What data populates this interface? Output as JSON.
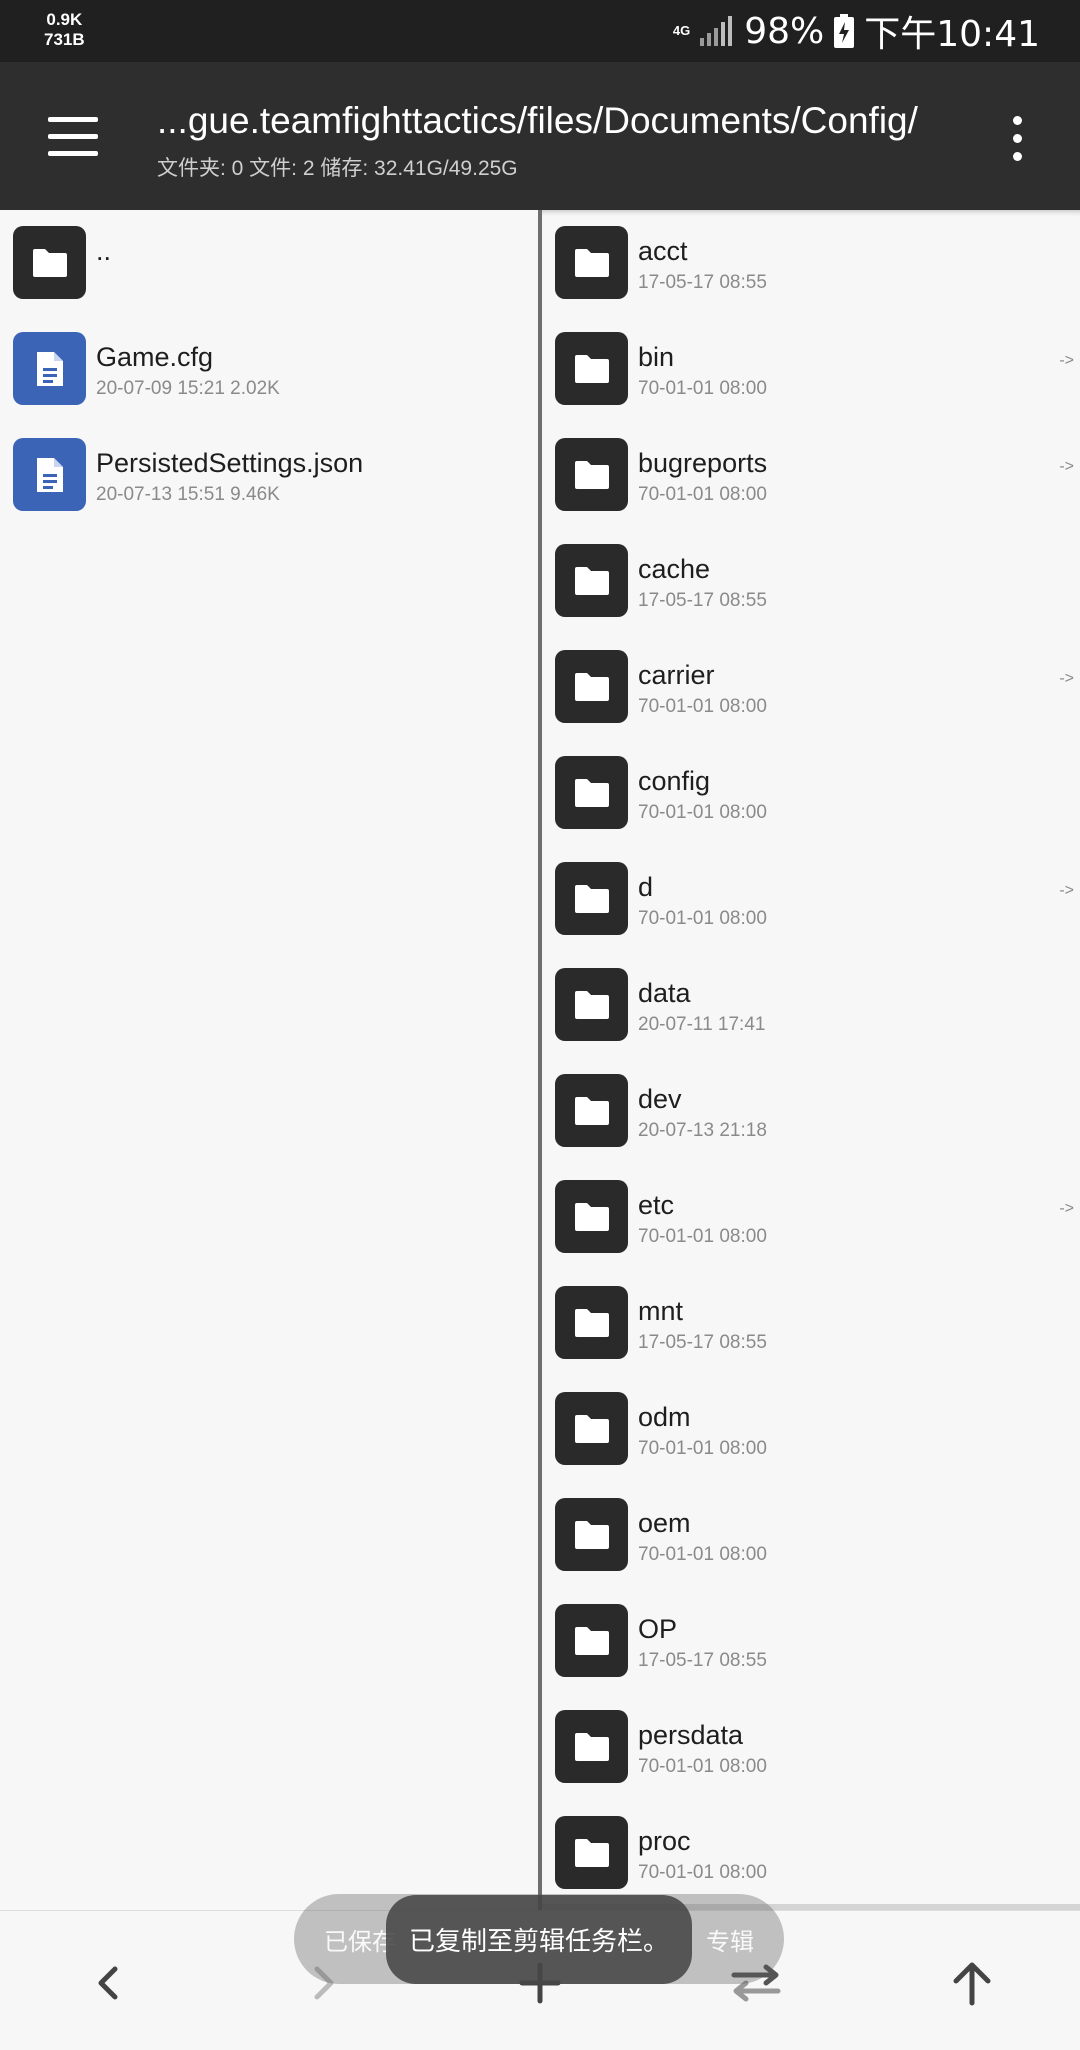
{
  "status_bar": {
    "net_speed_up": "0.9K",
    "net_speed_down": "731B",
    "network_type": "4G",
    "battery": "98%",
    "time": "下午10:41"
  },
  "toolbar": {
    "path": "...gue.teamfighttactics/files/Documents/Config/",
    "stats": "文件夹: 0  文件: 2  储存: 32.41G/49.25G",
    "menu_icon": "hamburger-menu-icon",
    "more_icon": "more-vertical-icon"
  },
  "left_pane": {
    "items": [
      {
        "name": "..",
        "meta": "",
        "type": "folder"
      },
      {
        "name": "Game.cfg",
        "meta": "20-07-09 15:21   2.02K",
        "type": "file"
      },
      {
        "name": "PersistedSettings.json",
        "meta": "20-07-13 15:51   9.46K",
        "type": "file"
      }
    ]
  },
  "right_pane": {
    "items": [
      {
        "name": "acct",
        "meta": "17-05-17 08:55",
        "link": ""
      },
      {
        "name": "bin",
        "meta": "70-01-01 08:00",
        "link": "->"
      },
      {
        "name": "bugreports",
        "meta": "70-01-01 08:00",
        "link": "->"
      },
      {
        "name": "cache",
        "meta": "17-05-17 08:55",
        "link": ""
      },
      {
        "name": "carrier",
        "meta": "70-01-01 08:00",
        "link": "->"
      },
      {
        "name": "config",
        "meta": "70-01-01 08:00",
        "link": ""
      },
      {
        "name": "d",
        "meta": "70-01-01 08:00",
        "link": "->"
      },
      {
        "name": "data",
        "meta": "20-07-11 17:41",
        "link": ""
      },
      {
        "name": "dev",
        "meta": "20-07-13 21:18",
        "link": ""
      },
      {
        "name": "etc",
        "meta": "70-01-01 08:00",
        "link": "->"
      },
      {
        "name": "mnt",
        "meta": "17-05-17 08:55",
        "link": ""
      },
      {
        "name": "odm",
        "meta": "70-01-01 08:00",
        "link": ""
      },
      {
        "name": "oem",
        "meta": "70-01-01 08:00",
        "link": ""
      },
      {
        "name": "OP",
        "meta": "17-05-17 08:55",
        "link": ""
      },
      {
        "name": "persdata",
        "meta": "70-01-01 08:00",
        "link": ""
      },
      {
        "name": "proc",
        "meta": "70-01-01 08:00",
        "link": ""
      }
    ]
  },
  "bottom_nav": {
    "icons": [
      "back-arrow-icon",
      "forward-arrow-icon",
      "add-icon",
      "swap-icon",
      "up-arrow-icon"
    ]
  },
  "toasts": {
    "background_left": "已保存",
    "background_right": "专辑",
    "foreground": "已复制至剪辑任务栏。"
  }
}
